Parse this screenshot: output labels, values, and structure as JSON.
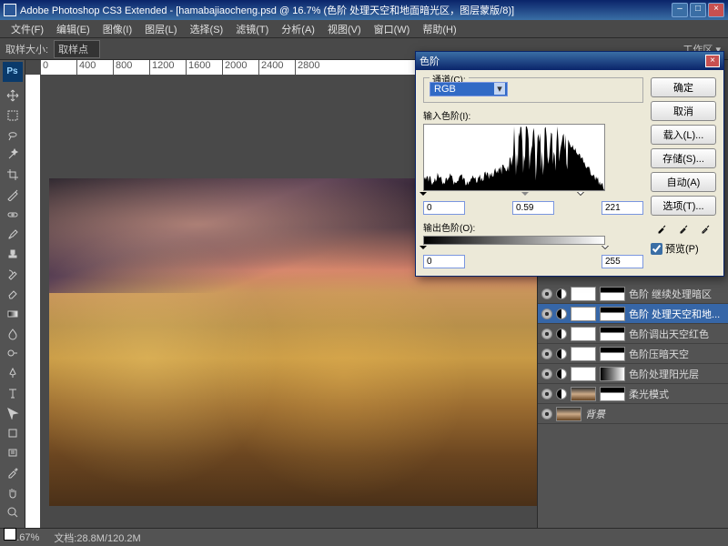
{
  "title": "Adobe Photoshop CS3 Extended - [hamabajiaocheng.psd @ 16.7% (色阶 处理天空和地面暗光区，图层蒙版/8)]",
  "menu": {
    "file": "文件(F)",
    "edit": "编辑(E)",
    "image": "图像(I)",
    "layer": "图层(L)",
    "select": "选择(S)",
    "filter": "滤镜(T)",
    "analysis": "分析(A)",
    "view": "视图(V)",
    "window": "窗口(W)",
    "help": "帮助(H)"
  },
  "options": {
    "sample_label": "取样大小:",
    "sample_value": "取样点"
  },
  "workspace": "工作区 ▾",
  "ruler_marks": [
    "0",
    "400",
    "800",
    "1200",
    "1600",
    "2000",
    "2400",
    "2800"
  ],
  "status": {
    "zoom": "16.67%",
    "doc": "文档:28.8M/120.2M"
  },
  "dialog": {
    "title": "色阶",
    "channel_label": "通道(C):",
    "channel_value": "RGB",
    "input_label": "输入色阶(I):",
    "in_black": "0",
    "in_gamma": "0.59",
    "in_white": "221",
    "output_label": "输出色阶(O):",
    "out_black": "0",
    "out_white": "255",
    "buttons": {
      "ok": "确定",
      "cancel": "取消",
      "load": "载入(L)...",
      "save": "存储(S)...",
      "auto": "自动(A)",
      "options": "选项(T)..."
    },
    "preview": "预览(P)"
  },
  "layers": [
    {
      "name": "色阶 继续处理暗区",
      "mask": "b"
    },
    {
      "name": "色阶 处理天空和地...",
      "mask": "b",
      "sel": true
    },
    {
      "name": "色阶调出天空红色",
      "mask": "b"
    },
    {
      "name": "色阶压暗天空",
      "mask": "b"
    },
    {
      "name": "色阶处理阳光层",
      "mask": "g"
    },
    {
      "name": "柔光模式",
      "mask": "b",
      "img": true
    },
    {
      "name": "背景",
      "bg": true
    }
  ]
}
